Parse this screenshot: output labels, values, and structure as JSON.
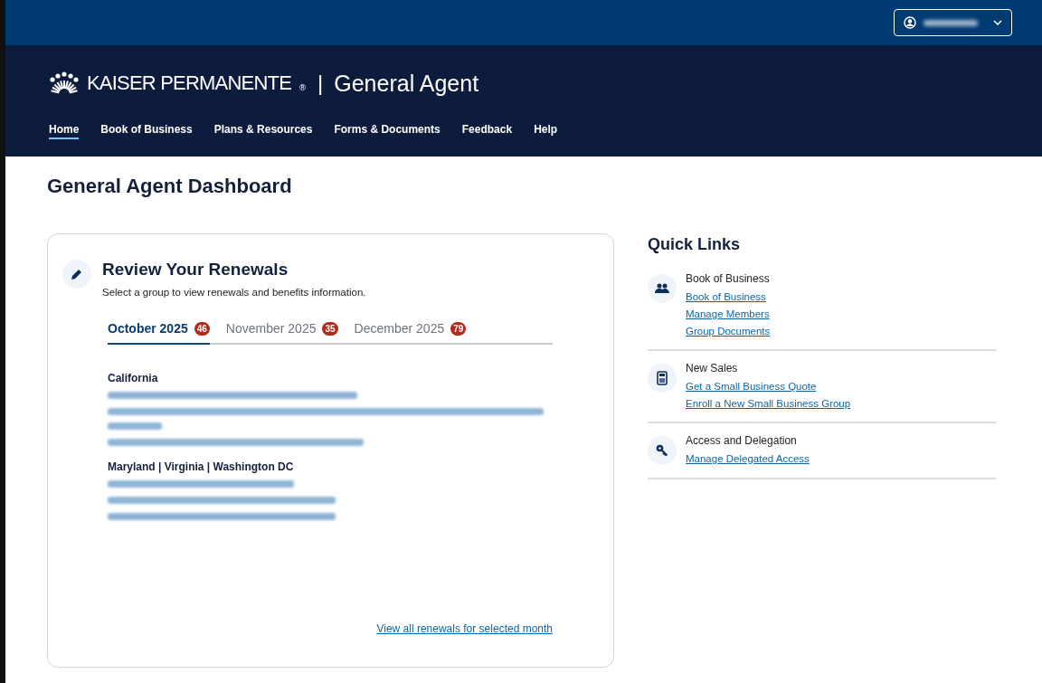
{
  "user_menu": {
    "name_blurred": true
  },
  "brand": {
    "name": "KAISER PERMANENTE",
    "mark": "®",
    "separator": "|",
    "product": "General Agent"
  },
  "nav": [
    {
      "label": "Home",
      "selected": true
    },
    {
      "label": "Book of Business",
      "selected": false
    },
    {
      "label": "Plans & Resources",
      "selected": false
    },
    {
      "label": "Forms & Documents",
      "selected": false
    },
    {
      "label": "Feedback",
      "selected": false
    },
    {
      "label": "Help",
      "selected": false
    }
  ],
  "page_title": "General Agent Dashboard",
  "renewals": {
    "title": "Review Your Renewals",
    "subtitle": "Select a group to view renewals and benefits information.",
    "tabs": [
      {
        "label": "October 2025",
        "count": "46",
        "selected": true
      },
      {
        "label": "November 2025",
        "count": "35",
        "selected": false
      },
      {
        "label": "December 2025",
        "count": "79",
        "selected": false
      }
    ],
    "groups": [
      {
        "name": "California",
        "entries": [
          {
            "kind": "redacted",
            "wrapped": false
          },
          {
            "kind": "redacted",
            "wrapped": true
          },
          {
            "kind": "redacted",
            "wrapped": false
          }
        ]
      },
      {
        "name": "Maryland | Virginia | Washington DC",
        "entries": [
          {
            "kind": "redacted",
            "wrapped": false
          },
          {
            "kind": "redacted",
            "wrapped": false
          },
          {
            "kind": "redacted",
            "wrapped": false
          }
        ]
      }
    ],
    "view_all": "View all renewals for selected month"
  },
  "quick_links": {
    "title": "Quick Links",
    "sections": [
      {
        "kind": "people",
        "title": "Book of Business",
        "links": [
          "Book of Business",
          "Manage Members",
          "Group Documents"
        ]
      },
      {
        "kind": "calculator",
        "title": "New Sales",
        "links": [
          "Get a Small Business Quote",
          "Enroll a New Small Business Group"
        ]
      },
      {
        "kind": "key",
        "title": "Access and Delegation",
        "links": [
          "Manage Delegated Access"
        ]
      }
    ]
  }
}
